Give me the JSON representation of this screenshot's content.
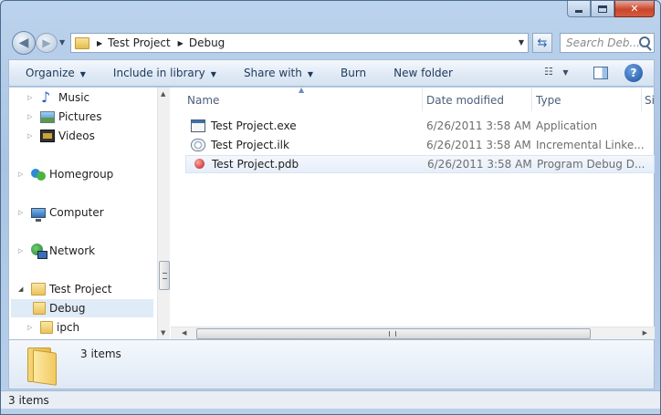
{
  "window": {
    "caption_buttons": [
      "minimize",
      "maximize",
      "close"
    ]
  },
  "navbar": {
    "breadcrumbs": [
      "Test Project",
      "Debug"
    ],
    "search_placeholder": "Search Deb..."
  },
  "toolbar": {
    "items": [
      {
        "label": "Organize",
        "dropdown": true
      },
      {
        "label": "Include in library",
        "dropdown": true
      },
      {
        "label": "Share with",
        "dropdown": true
      },
      {
        "label": "Burn",
        "dropdown": false
      },
      {
        "label": "New folder",
        "dropdown": false
      }
    ]
  },
  "sidebar": {
    "items": [
      {
        "label": "Music",
        "icon": "music-icon"
      },
      {
        "label": "Pictures",
        "icon": "pictures-icon"
      },
      {
        "label": "Videos",
        "icon": "videos-icon"
      },
      {
        "label": "Homegroup",
        "icon": "homegroup-icon"
      },
      {
        "label": "Computer",
        "icon": "computer-icon"
      },
      {
        "label": "Network",
        "icon": "network-icon"
      },
      {
        "label": "Test Project",
        "icon": "folder-icon",
        "expanded": true
      },
      {
        "label": "Debug",
        "icon": "folder-icon",
        "selected": true
      },
      {
        "label": "ipch",
        "icon": "folder-icon"
      }
    ]
  },
  "files": {
    "columns": [
      "Name",
      "Date modified",
      "Type",
      "Size"
    ],
    "rows": [
      {
        "name": "Test Project.exe",
        "date": "6/26/2011 3:58 AM",
        "type": "Application",
        "icon": "exe-icon"
      },
      {
        "name": "Test Project.ilk",
        "date": "6/26/2011 3:58 AM",
        "type": "Incremental Linke...",
        "icon": "ilk-icon"
      },
      {
        "name": "Test Project.pdb",
        "date": "6/26/2011 3:58 AM",
        "type": "Program Debug D...",
        "icon": "pdb-icon",
        "selected": true
      }
    ]
  },
  "details": {
    "count": "3 items"
  },
  "statusbar": {
    "text": "3 items"
  }
}
